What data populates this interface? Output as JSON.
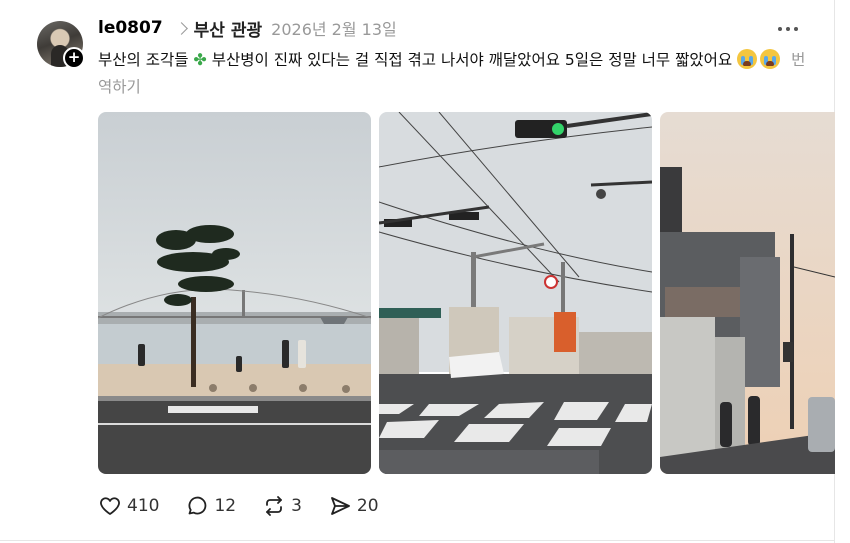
{
  "post": {
    "username": "le0807",
    "topic": "부산 관광",
    "date": "2026년 2월 13일",
    "text_part1": "부산의 조각들 ",
    "text_part2": " 부산병이 진짜 있다는 걸 직접 겪고 나서야 깨달았어요  5일은 정말 너무 짧았어요 ",
    "translate_label": "번역하기",
    "clover_icon": "four-leaf-clover-icon",
    "cry_icon": "loudly-crying-face-icon"
  },
  "photos": [
    {
      "alt": "beach-pine-tree-bridge-photo"
    },
    {
      "alt": "crosswalk-traffic-light-photo"
    },
    {
      "alt": "street-sunset-photo"
    }
  ],
  "actions": {
    "likes": "410",
    "comments": "12",
    "reposts": "3",
    "shares": "20"
  },
  "colors": {
    "accent_text": "#000000",
    "muted_text": "#999999",
    "clover": "#3aa84a"
  }
}
